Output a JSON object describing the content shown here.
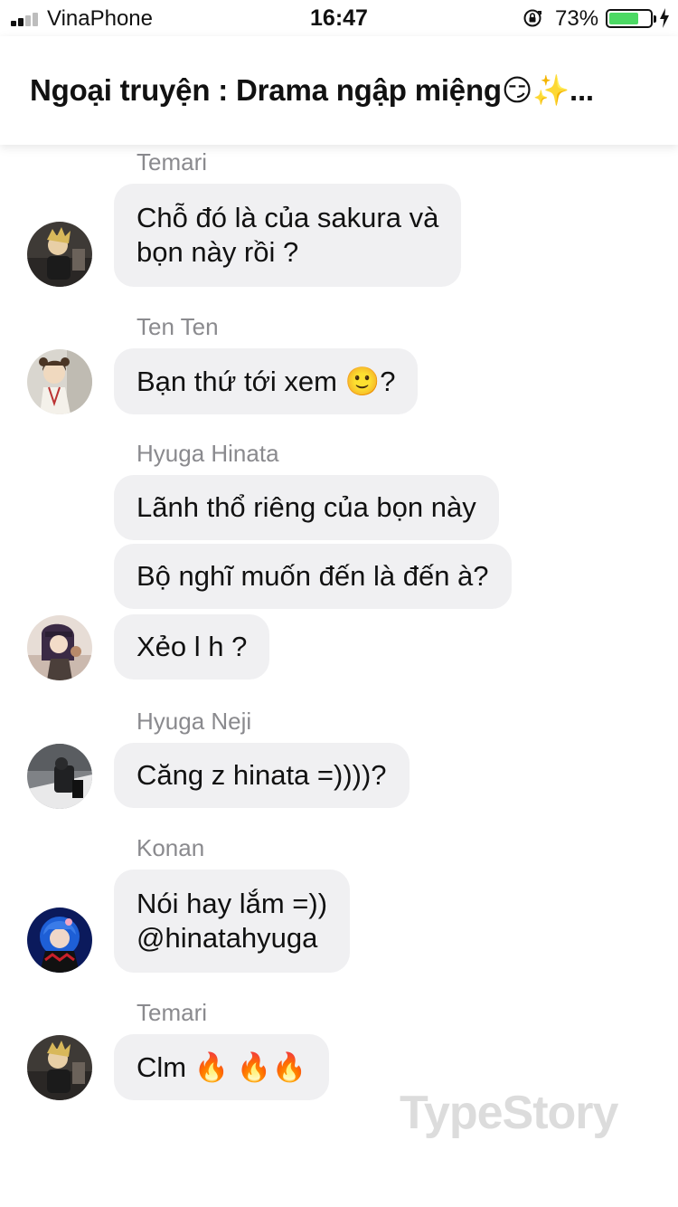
{
  "status_bar": {
    "carrier": "VinaPhone",
    "time": "16:47",
    "battery_percent": "73%",
    "battery_level": 0.73,
    "battery_color": "#4cd964"
  },
  "header": {
    "title": "Ngoại truyện : Drama ngập miệng😏✨..."
  },
  "messages": [
    {
      "sender": "Temari",
      "lines": [
        "Chỗ đó là của sakura và",
        "bọn này rồi ?"
      ]
    },
    {
      "sender": "Ten Ten",
      "text": "Bạn thứ tới xem 🙂?"
    },
    {
      "sender": "Hyuga Hinata",
      "texts": [
        "Lãnh thổ riêng của bọn này",
        "Bộ nghĩ muốn đến là đến à?",
        "Xẻo l h ?"
      ]
    },
    {
      "sender": "Hyuga Neji",
      "text": "Căng z hinata =))))?"
    },
    {
      "sender": "Konan",
      "lines": [
        "Nói hay lắm =))",
        "@hinatahyuga"
      ]
    },
    {
      "sender": "Temari",
      "text": "Clm 🔥 🔥🔥"
    }
  ],
  "watermark": "TypeStory",
  "colors": {
    "bubble": "#f0f0f2",
    "sender_name": "#8a8a8e"
  }
}
